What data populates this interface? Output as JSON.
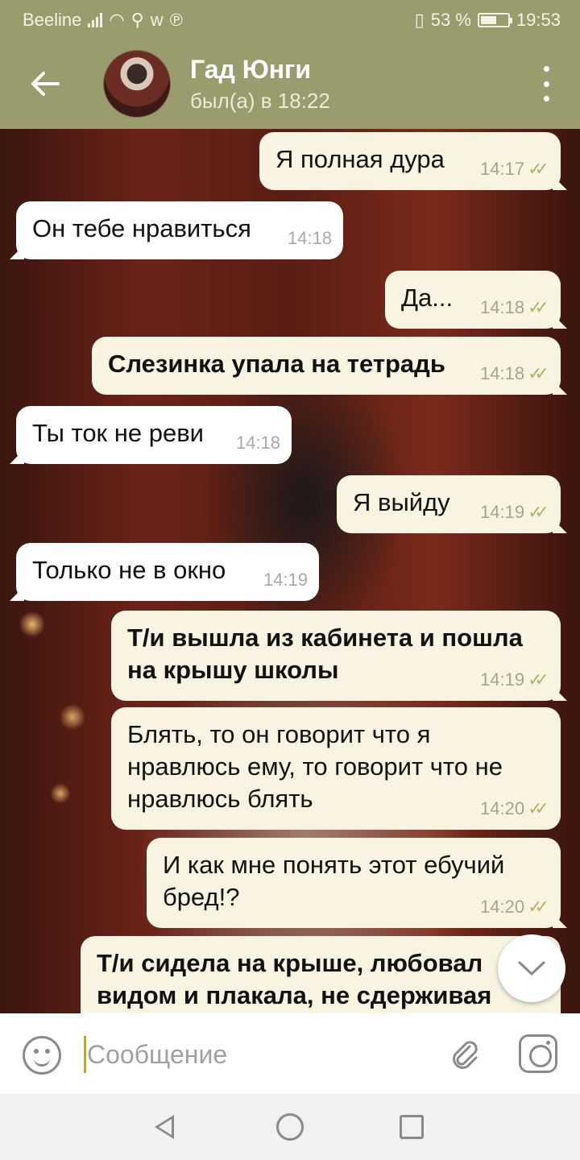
{
  "status_bar": {
    "carrier": "Beeline",
    "battery": "53 %",
    "time": "19:53"
  },
  "header": {
    "contact_name": "Гад Юнги",
    "last_seen": "был(а) в 18:22"
  },
  "messages": [
    {
      "text": "Я полная дура",
      "time": "14:17"
    },
    {
      "text": "Он тебе нравиться",
      "time": "14:18"
    },
    {
      "text": "Да...",
      "time": "14:18"
    },
    {
      "text": "Слезинка упала на тетрадь",
      "time": "14:18"
    },
    {
      "text": "Ты ток не реви",
      "time": "14:18"
    },
    {
      "text": "Я выйду",
      "time": "14:19"
    },
    {
      "text": "Только не в окно",
      "time": "14:19"
    },
    {
      "text": "Т/и вышла из кабинета и пошла на крышу школы",
      "time": "14:19"
    },
    {
      "text": "Блять, то он говорит что я нравлюсь ему, то говорит что не нравлюсь блять",
      "time": "14:20"
    },
    {
      "text": "И как мне понять этот ебучий бред!?",
      "time": "14:20"
    },
    {
      "text": "Т/и сидела на крыше, любовал видом и плакала, не сдерживая"
    }
  ],
  "composer": {
    "placeholder": "Сообщение"
  },
  "icons": {
    "back": "arrow-left-icon",
    "menu": "more-vert-icon",
    "emoji": "emoji-icon",
    "attach": "paperclip-icon",
    "camera": "camera-icon",
    "scroll": "chevron-down-icon"
  },
  "colors": {
    "header": "#9a9c6e",
    "outgoing_bubble": "#f8f4e1",
    "incoming_bubble": "#ffffff",
    "read_tick": "#b8b065"
  }
}
